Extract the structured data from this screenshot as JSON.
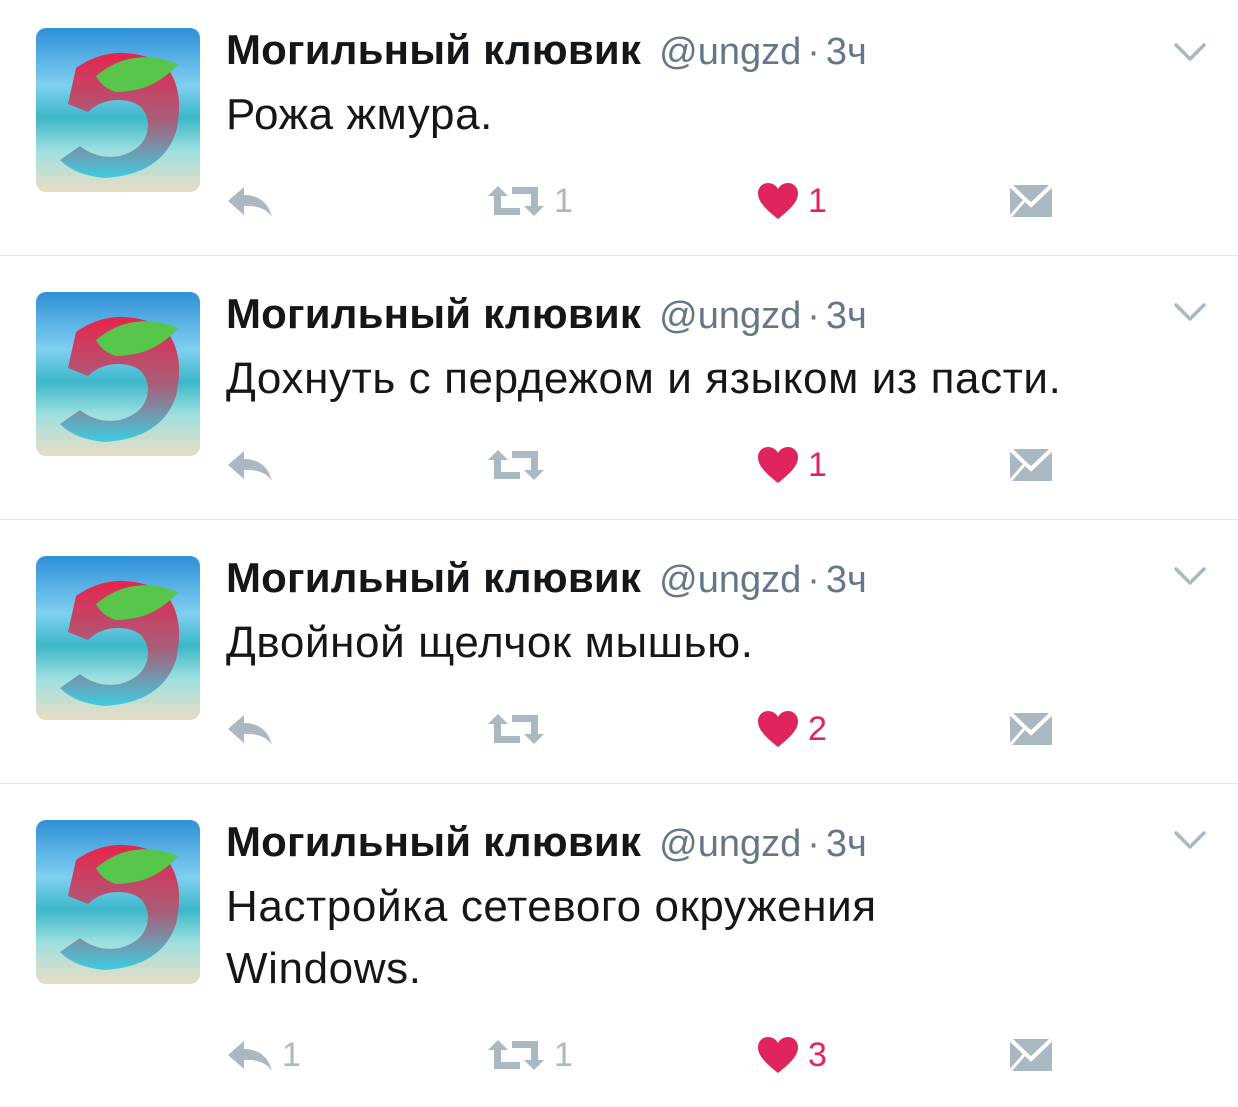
{
  "colors": {
    "name": "#14171a",
    "meta": "#657786",
    "icon": "#aab8c2",
    "like": "#e0245e",
    "divider": "#e1e8ed"
  },
  "icons": {
    "avatar": "avatar-logo",
    "caret": "chevron-down-icon",
    "reply": "reply-icon",
    "retweet": "retweet-icon",
    "like": "heart-icon",
    "dm": "envelope-icon"
  },
  "tweets": [
    {
      "name": "Могильный клювик",
      "handle": "@ungzd",
      "separator": "·",
      "time": "3ч",
      "text": "Рожа жмура.",
      "reply_count": "",
      "retweet_count": "1",
      "like_count": "1"
    },
    {
      "name": "Могильный клювик",
      "handle": "@ungzd",
      "separator": "·",
      "time": "3ч",
      "text": "Дохнуть с пердежом и языком из пасти.",
      "reply_count": "",
      "retweet_count": "",
      "like_count": "1"
    },
    {
      "name": "Могильный клювик",
      "handle": "@ungzd",
      "separator": "·",
      "time": "3ч",
      "text": "Двойной щелчок мышью.",
      "reply_count": "",
      "retweet_count": "",
      "like_count": "2"
    },
    {
      "name": "Могильный клювик",
      "handle": "@ungzd",
      "separator": "·",
      "time": "3ч",
      "text": "Настройка сетевого окружения Windows.",
      "reply_count": "1",
      "retweet_count": "1",
      "like_count": "3"
    }
  ]
}
